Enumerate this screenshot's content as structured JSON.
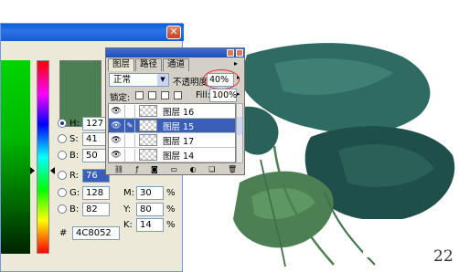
{
  "picker": {
    "hsb": [
      {
        "label": "H:",
        "value": "127",
        "unit": "度"
      },
      {
        "label": "S:",
        "value": "41",
        "unit": "%"
      },
      {
        "label": "B:",
        "value": "50",
        "unit": "%"
      }
    ],
    "rgb": [
      {
        "label": "R:",
        "value": "76"
      },
      {
        "label": "G:",
        "value": "128"
      },
      {
        "label": "B:",
        "value": "82"
      }
    ],
    "cmyk": [
      {
        "label": "M:",
        "value": "30",
        "unit": "%"
      },
      {
        "label": "Y:",
        "value": "80",
        "unit": "%"
      },
      {
        "label": "K:",
        "value": "14",
        "unit": "%"
      }
    ],
    "hex_label": "#",
    "hex": "4C8052",
    "swatch_color": "#4c8052"
  },
  "layers_panel": {
    "tabs": [
      "图层",
      "路径",
      "通道"
    ],
    "blend_mode": "正常",
    "opacity_label": "不透明度:",
    "opacity": "40%",
    "lock_label": "锁定:",
    "fill_label": "Fill:",
    "fill": "100%",
    "layers": [
      {
        "name": "图层 16",
        "selected": false
      },
      {
        "name": "图层 15",
        "selected": true
      },
      {
        "name": "图层 17",
        "selected": false
      },
      {
        "name": "图层 14",
        "selected": false
      }
    ],
    "selection_color": "#3a5fb8"
  },
  "page_number": "22"
}
